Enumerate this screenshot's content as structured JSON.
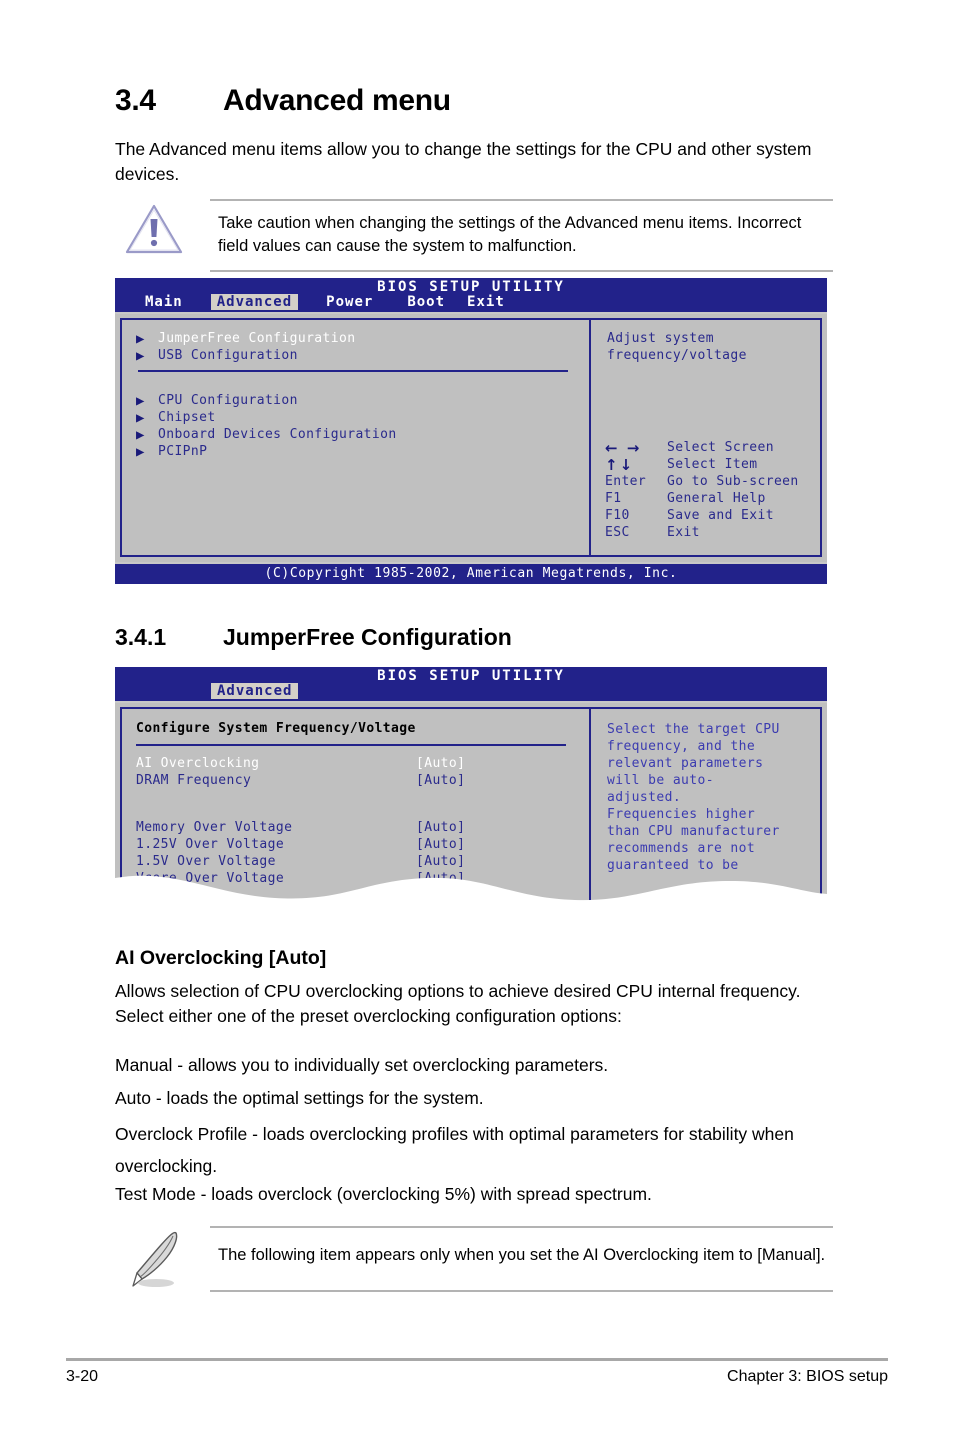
{
  "section": {
    "number": "3.4",
    "title": "Advanced menu",
    "intro": "The Advanced menu items allow you to change the settings for the CPU and other system devices."
  },
  "caution_note": {
    "icon": "warning-triangle-icon",
    "text": "Take caution when changing the settings of the Advanced menu items. Incorrect field values can cause the system to malfunction."
  },
  "bios_advanced": {
    "title": "BIOS SETUP UTILITY",
    "tabs": [
      {
        "label": "Main",
        "active": false
      },
      {
        "label": "Advanced",
        "active": true
      },
      {
        "label": "Power",
        "active": false
      },
      {
        "label": "Boot",
        "active": false
      },
      {
        "label": "Exit",
        "active": false
      }
    ],
    "menu_group_1": [
      {
        "label": "JumperFree Configuration",
        "selected": true
      },
      {
        "label": "USB Configuration",
        "selected": false
      }
    ],
    "menu_group_2": [
      {
        "label": "CPU Configuration",
        "selected": false
      },
      {
        "label": "Chipset",
        "selected": false
      },
      {
        "label": "Onboard Devices Configuration",
        "selected": false
      },
      {
        "label": "PCIPnP",
        "selected": false
      }
    ],
    "help": "Adjust system\nfrequency/voltage",
    "keys": [
      {
        "key": "← →",
        "desc": "Select Screen",
        "glyph": true
      },
      {
        "key": "↑↓",
        "desc": "Select Item",
        "glyph": true
      },
      {
        "key": "Enter",
        "desc": "Go to Sub-screen",
        "glyph": false
      },
      {
        "key": "F1",
        "desc": "General Help",
        "glyph": false
      },
      {
        "key": "F10",
        "desc": "Save and Exit",
        "glyph": false
      },
      {
        "key": "ESC",
        "desc": "Exit",
        "glyph": false
      }
    ],
    "footer": "(C)Copyright 1985-2002, American Megatrends, Inc."
  },
  "subsection": {
    "number": "3.4.1",
    "title": "JumperFree Configuration"
  },
  "bios_jumperfree": {
    "title": "BIOS SETUP UTILITY",
    "tab": "Advanced",
    "config_heading": "Configure System Frequency/Voltage",
    "options_group_1": [
      {
        "label": "AI Overclocking",
        "value": "[Auto]",
        "selected": true
      },
      {
        "label": "DRAM Frequency",
        "value": "[Auto]",
        "selected": false
      }
    ],
    "options_group_2": [
      {
        "label": "Memory Over Voltage",
        "value": "[Auto]",
        "selected": false
      },
      {
        "label": "1.25V Over Voltage",
        "value": "[Auto]",
        "selected": false
      },
      {
        "label": "1.5V Over Voltage",
        "value": "[Auto]",
        "selected": false
      },
      {
        "label": "Vcore Over Voltage",
        "value": "[Auto]",
        "selected": false
      }
    ],
    "help": "Select the target CPU\nfrequency, and the\nrelevant parameters\nwill be auto-\nadjusted.\nFrequencies higher\nthan CPU manufacturer\nrecommends are not\nguaranteed to be"
  },
  "item": {
    "heading": "AI Overclocking [Auto]",
    "description": "Allows selection of CPU overclocking options to achieve desired CPU internal frequency. Select either one of the preset overclocking configuration options:",
    "options": [
      "Manual - allows you to individually set overclocking parameters.",
      "Auto - loads the optimal settings for the system.",
      "Overclock Profile - loads overclocking profiles with optimal parameters for stability when overclocking.",
      "Test Mode - loads overclock (overclocking 5%) with spread spectrum."
    ]
  },
  "info_note": {
    "icon": "pencil-note-icon",
    "text": "The following item appears only when you set the AI Overclocking item to [Manual]."
  },
  "page_footer": {
    "page_number": "3-20",
    "chapter": "Chapter 3: BIOS setup"
  },
  "colors": {
    "bios_blue": "#22228a",
    "bios_gray": "#c0c0c0",
    "bios_text_blue": "#2a2a8c",
    "rule_gray": "#b3b3b3",
    "accent_purple": "#7b7bc0"
  }
}
